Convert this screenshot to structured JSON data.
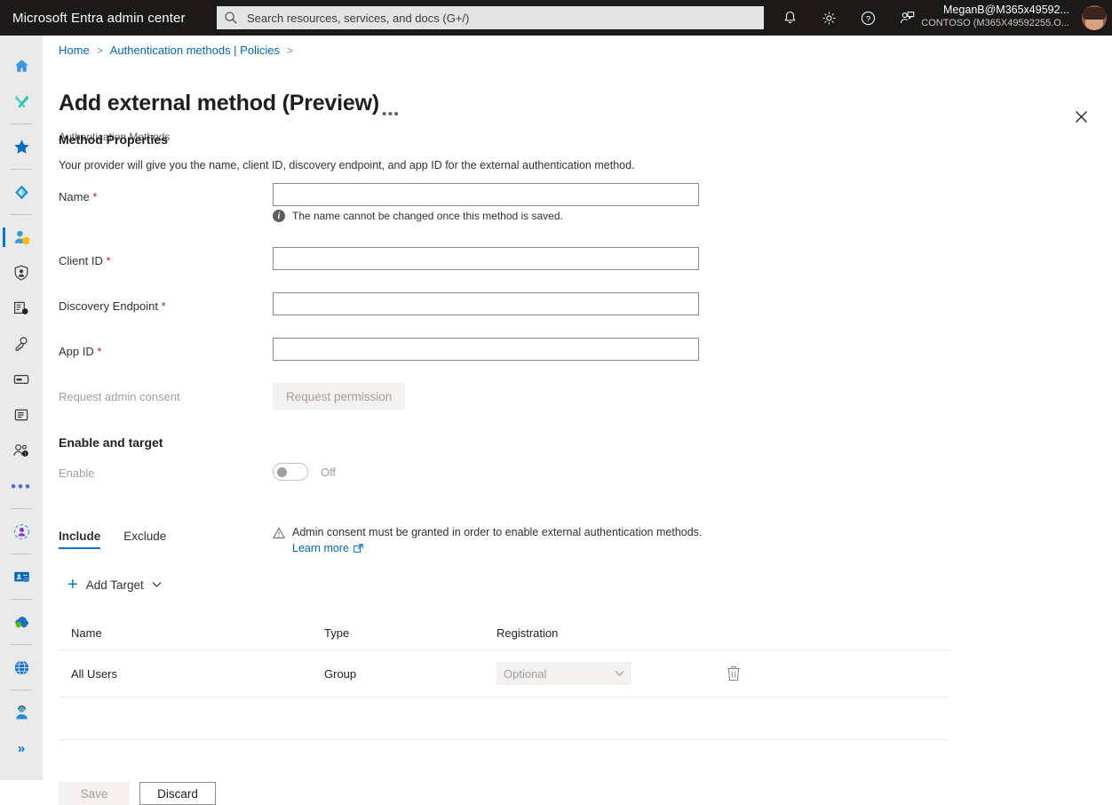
{
  "topbar": {
    "brand": "Microsoft Entra admin center",
    "search_placeholder": "Search resources, services, and docs (G+/)",
    "icons": [
      "notification-bell-icon",
      "settings-gear-icon",
      "help-question-icon",
      "feedback-icon"
    ],
    "account_name": "MeganB@M365x49592...",
    "account_tenant": "CONTOSO (M365X49592255.O..."
  },
  "rail": {
    "items": [
      {
        "name": "home",
        "icon": "home-icon"
      },
      {
        "name": "diagnose-solve",
        "icon": "tools-icon"
      },
      {
        "name": "favorites",
        "icon": "star-icon"
      },
      {
        "name": "identity",
        "icon": "entra-diamond-icon"
      },
      {
        "name": "protection",
        "icon": "user-shield-icon",
        "selected": true
      },
      {
        "name": "identity-governance",
        "icon": "badge-shield-icon"
      },
      {
        "name": "verified-id",
        "icon": "id-card-badge-icon"
      },
      {
        "name": "permissions-management",
        "icon": "key-icon"
      },
      {
        "name": "billing",
        "icon": "card-icon"
      },
      {
        "name": "reports",
        "icon": "document-icon"
      },
      {
        "name": "learn-support",
        "icon": "people-alert-icon"
      },
      {
        "name": "more",
        "icon": "ellipsis-icon"
      },
      {
        "name": "entra-id-protection",
        "icon": "person-circle-icon"
      },
      {
        "name": "verified-credentials",
        "icon": "id-card-icon"
      },
      {
        "name": "cloud-apps",
        "icon": "cloud-icon"
      },
      {
        "name": "global-secure-access",
        "icon": "globe-icon"
      },
      {
        "name": "support",
        "icon": "headset-person-icon"
      },
      {
        "name": "expand-rail",
        "icon": "double-chevron-right-icon"
      }
    ],
    "dots_label": "•••",
    "expand_label": "»"
  },
  "breadcrumb": {
    "home": "Home",
    "separator": ">",
    "parent": "Authentication methods | Policies",
    "trailing": ">"
  },
  "page": {
    "title": "Add external method (Preview)",
    "ellipsis": "•••",
    "subtitle": "Authentication Methods",
    "close_icon": "close-icon"
  },
  "method_properties": {
    "heading": "Method Properties",
    "description": "Your provider will give you the name, client ID, discovery endpoint, and app ID for the external authentication method.",
    "fields": [
      {
        "label": "Name",
        "required": "*",
        "value": "",
        "placeholder": ""
      },
      {
        "label": "Client ID",
        "required": "*",
        "value": "",
        "placeholder": ""
      },
      {
        "label": "Discovery Endpoint",
        "required": "*",
        "value": "",
        "placeholder": ""
      },
      {
        "label": "App ID",
        "required": "*",
        "value": "",
        "placeholder": ""
      }
    ],
    "name_hint": "The name cannot be changed once this method is saved.",
    "consent_label": "Request admin consent",
    "consent_button": "Request permission"
  },
  "enable_target": {
    "heading": "Enable and target",
    "enable_label": "Enable",
    "toggle_state": "Off",
    "warning": "Admin consent must be granted in order to enable external authentication methods.",
    "learn_more": "Learn more",
    "external_link_icon": "external-link-icon"
  },
  "tabs": [
    {
      "label": "Include",
      "active": true
    },
    {
      "label": "Exclude",
      "active": false
    }
  ],
  "add_target": {
    "plus_icon": "plus-icon",
    "label": "Add Target",
    "chevron_icon": "chevron-down-icon"
  },
  "table": {
    "columns": [
      "Name",
      "Type",
      "Registration"
    ],
    "rows": [
      {
        "name": "All Users",
        "type": "Group",
        "registration": "Optional",
        "delete_icon": "trash-icon"
      }
    ]
  },
  "footer": {
    "save_label": "Save",
    "discard_label": "Discard"
  },
  "colors": {
    "accent": "#0078d4",
    "link": "#0067b8",
    "topbar_bg": "#1b1a19",
    "rail_bg": "#eaeaea",
    "required_red": "#a4262c",
    "disabled_text": "#a19f9d"
  }
}
